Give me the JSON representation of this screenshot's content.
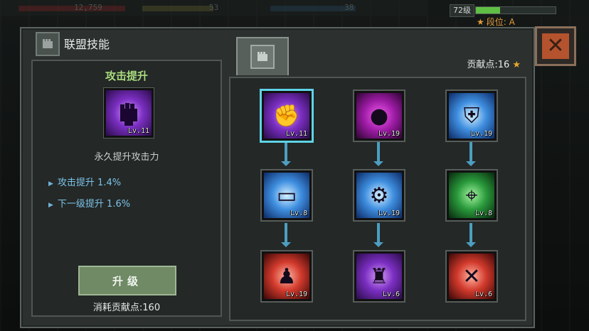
{
  "hud": {
    "stat_a": "12,759",
    "stat_b": "53",
    "stat_c": "38",
    "player_level": "72级",
    "level_progress": 0.3,
    "rank_label": "段位: A"
  },
  "window": {
    "title": "联盟技能",
    "contribution_label": "贡献点:16",
    "close_label": "✕"
  },
  "selected_skill": {
    "name": "攻击提升",
    "level": "Lv.11",
    "description": "永久提升攻击力",
    "current_bonus": "攻击提升 1.4%",
    "next_bonus": "下一级提升 1.6%",
    "upgrade_label": "升级",
    "cost_label": "消耗贡献点:160"
  },
  "skills": [
    {
      "name": "attack-boost",
      "level": "Lv.11",
      "theme": "purple",
      "glyph": "✊"
    },
    {
      "name": "defense-boost",
      "level": "Lv.19",
      "theme": "magenta",
      "glyph": "●"
    },
    {
      "name": "armor-boost",
      "level": "Lv.19",
      "theme": "blue",
      "glyph": "⛨"
    },
    {
      "name": "goggles-boost",
      "level": "Lv.8",
      "theme": "blue",
      "glyph": "▭"
    },
    {
      "name": "weapon-boost",
      "level": "Lv.19",
      "theme": "blue",
      "glyph": "⚙"
    },
    {
      "name": "crosshair-boost",
      "level": "Lv.8",
      "theme": "green",
      "glyph": "⌖"
    },
    {
      "name": "rage-boost",
      "level": "Lv.19",
      "theme": "red",
      "glyph": "♟"
    },
    {
      "name": "heavy-weapon-boost",
      "level": "Lv.6",
      "theme": "purple",
      "glyph": "♜"
    },
    {
      "name": "sniper-boost",
      "level": "Lv.6",
      "theme": "red",
      "glyph": "✕"
    }
  ],
  "colors": {
    "accent_green": "#a9dd7e",
    "stat_blue": "#7cc3e8",
    "close_orange": "#b4532d",
    "selected_outline": "#5fd3e6"
  }
}
